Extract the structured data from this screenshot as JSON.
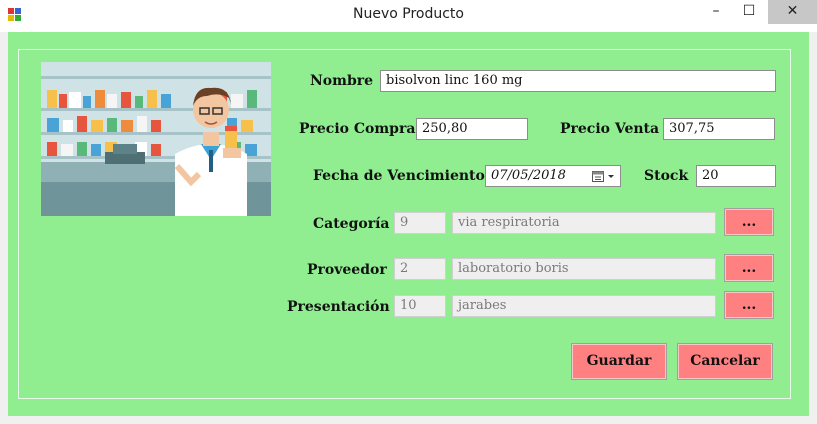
{
  "window": {
    "title": "Nuevo Producto"
  },
  "controls": {
    "minimize": "–",
    "maximize": "☐",
    "close": "✕"
  },
  "form": {
    "nombre": {
      "label": "Nombre",
      "value": "bisolvon linc 160 mg"
    },
    "precio_compra": {
      "label": "Precio Compra",
      "value": "250,80"
    },
    "precio_venta": {
      "label": "Precio Venta",
      "value": "307,75"
    },
    "fecha_vencimiento": {
      "label": "Fecha de Vencimiento",
      "value": "07/05/2018"
    },
    "stock": {
      "label": "Stock",
      "value": "20"
    },
    "categoria": {
      "label": "Categoría",
      "id": "9",
      "name": "via respiratoria",
      "button": "..."
    },
    "proveedor": {
      "label": "Proveedor",
      "id": "2",
      "name": "laboratorio boris",
      "button": "..."
    },
    "presentacion": {
      "label": "Presentación",
      "id": "10",
      "name": "jarabes",
      "button": "..."
    }
  },
  "buttons": {
    "guardar": "Guardar",
    "cancelar": "Cancelar"
  },
  "colors": {
    "form_bg": "#90ee90",
    "button_bg": "#ff8080",
    "window_bg": "#f0f0f0"
  },
  "image": {
    "subject": "pharmacist-illustration"
  }
}
